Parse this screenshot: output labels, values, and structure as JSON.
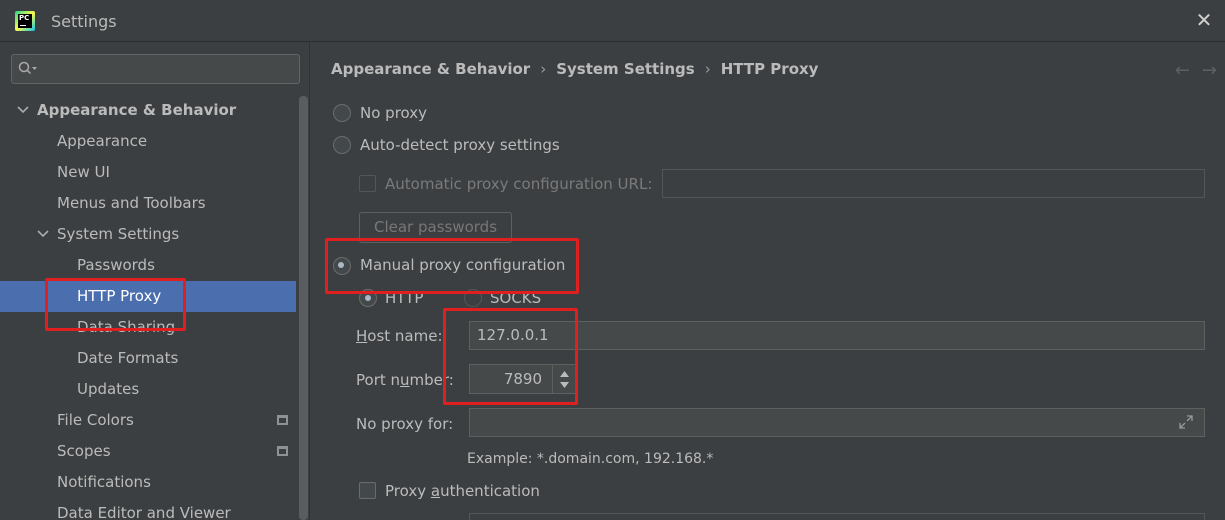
{
  "window": {
    "title": "Settings",
    "close": "✕",
    "app_icon_text": "PC"
  },
  "sidebar": {
    "search_placeholder": "",
    "items": [
      {
        "label": "Appearance & Behavior",
        "level": 0,
        "expanded": true,
        "bold": true
      },
      {
        "label": "Appearance",
        "level": 1
      },
      {
        "label": "New UI",
        "level": 1
      },
      {
        "label": "Menus and Toolbars",
        "level": 1
      },
      {
        "label": "System Settings",
        "level": 1,
        "expanded": true
      },
      {
        "label": "Passwords",
        "level": 2
      },
      {
        "label": "HTTP Proxy",
        "level": 2,
        "selected": true
      },
      {
        "label": "Data Sharing",
        "level": 2
      },
      {
        "label": "Date Formats",
        "level": 2
      },
      {
        "label": "Updates",
        "level": 2
      },
      {
        "label": "File Colors",
        "level": 1,
        "page_icon": true
      },
      {
        "label": "Scopes",
        "level": 1,
        "page_icon": true
      },
      {
        "label": "Notifications",
        "level": 1
      },
      {
        "label": "Data Editor and Viewer",
        "level": 1
      }
    ]
  },
  "breadcrumb": [
    "Appearance & Behavior",
    "System Settings",
    "HTTP Proxy"
  ],
  "nav": {
    "back": "←",
    "forward": "→"
  },
  "proxy": {
    "no_proxy": "No proxy",
    "auto_detect": "Auto-detect proxy settings",
    "auto_config_url_label": "Automatic proxy configuration URL:",
    "auto_config_url_value": "",
    "clear_passwords": "Clear passwords",
    "manual": "Manual proxy configuration",
    "http": "HTTP",
    "socks": "SOCKS",
    "host_label_mnemonic": "H",
    "host_label_rest": "ost name:",
    "host_value": "127.0.0.1",
    "port_label_pre": "Port n",
    "port_label_mnemonic": "u",
    "port_label_post": "mber:",
    "port_value": "7890",
    "no_proxy_for_label": "No proxy for:",
    "no_proxy_for_value": "",
    "example": "Example: *.domain.com, 192.168.*",
    "proxy_auth_pre": "Proxy ",
    "proxy_auth_mnemonic": "a",
    "proxy_auth_post": "uthentication"
  },
  "colors": {
    "accent": "#4b6eaf",
    "highlight": "#e02020",
    "background": "#3c3f41"
  }
}
